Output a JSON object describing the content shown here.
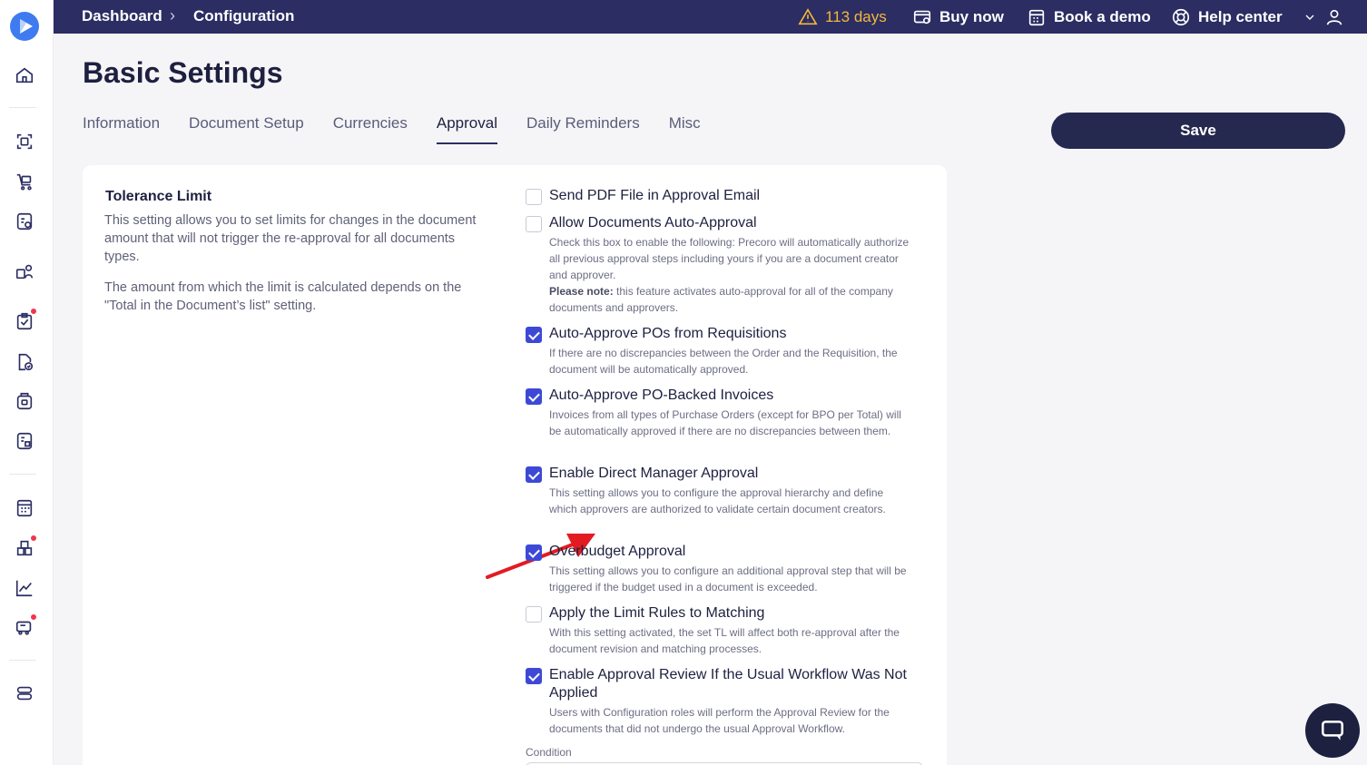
{
  "breadcrumb": {
    "home": "Dashboard",
    "current": "Configuration"
  },
  "topbar": {
    "trial": "113 days",
    "buy_now": "Buy now",
    "book_demo": "Book a demo",
    "help_center": "Help center"
  },
  "page": {
    "title": "Basic Settings"
  },
  "tabs": [
    {
      "label": "Information"
    },
    {
      "label": "Document Setup"
    },
    {
      "label": "Currencies"
    },
    {
      "label": "Approval"
    },
    {
      "label": "Daily Reminders"
    },
    {
      "label": "Misc"
    }
  ],
  "active_tab": "Approval",
  "save_label": "Save",
  "tolerance": {
    "title": "Tolerance Limit",
    "description": "This setting allows you to set limits for changes in the document amount that will not trigger the re-approval for all documents types.",
    "note": "The amount from which the limit is calculated depends on the \"Total in the Document’s list\" setting."
  },
  "options": [
    {
      "label": "Send PDF File in Approval Email",
      "checked": false,
      "desc": ""
    },
    {
      "label": "Allow Documents Auto-Approval",
      "checked": false,
      "desc": "Check this box to enable the following: Precoro will automatically authorize all previous approval steps including yours if you are a document creator and approver.",
      "note_bold": "Please note:",
      "note": " this feature activates auto-approval for all of the company documents and approvers."
    },
    {
      "label": "Auto-Approve POs from Requisitions",
      "checked": true,
      "desc": "If there are no discrepancies between the Order and the Requisition, the document will be automatically approved."
    },
    {
      "label": "Auto-Approve PO-Backed Invoices",
      "checked": true,
      "desc": "Invoices from all types of Purchase Orders (except for BPO per Total) will be automatically approved if there are no discrepancies between them."
    },
    {
      "label": "Enable Direct Manager Approval",
      "checked": true,
      "desc": "This setting allows you to configure the approval hierarchy and define which approvers are authorized to validate certain document creators."
    },
    {
      "label": "Overbudget Approval",
      "checked": true,
      "desc": "This setting allows you to configure an additional approval step that will be triggered if the budget used in a document is exceeded."
    },
    {
      "label": "Apply the Limit Rules to Matching",
      "checked": false,
      "desc": "With this setting activated, the set TL will affect both re-approval after the document revision and matching processes."
    },
    {
      "label": "Enable Approval Review If the Usual Workflow Was Not Applied",
      "checked": true,
      "desc": "Users with Configuration roles will perform the Approval Review for the documents that did not undergo the usual Approval Workflow."
    }
  ],
  "condition_label": "Condition",
  "colors": {
    "topbar": "#2b2d63",
    "accent": "#3d49d6",
    "save": "#25284f",
    "arrow": "#e21b23",
    "badge": "#f0364f"
  }
}
